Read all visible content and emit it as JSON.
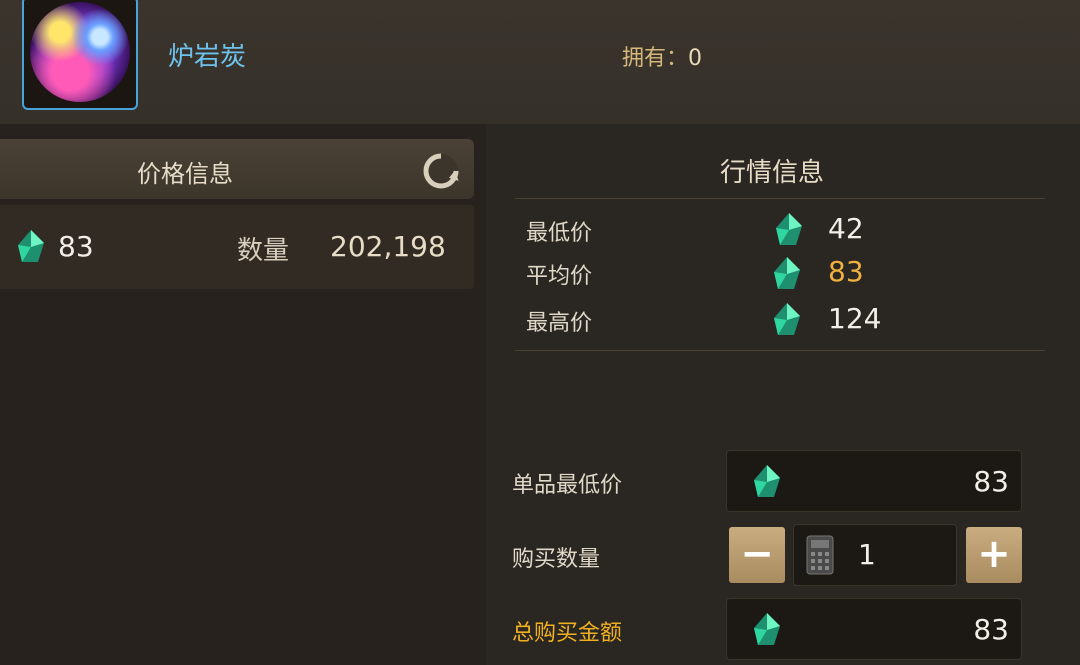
{
  "item": {
    "name": "炉岩炭",
    "owned_label": "拥有：",
    "owned_count": "0",
    "icon": "orb-icon"
  },
  "price_panel": {
    "title": "价格信息",
    "refresh_icon": "refresh-icon",
    "listing": {
      "price": "83",
      "qty_label": "数量",
      "qty": "202,198"
    }
  },
  "market": {
    "title": "行情信息",
    "rows": [
      {
        "label": "最低价",
        "value": "42"
      },
      {
        "label": "平均价",
        "value": "83"
      },
      {
        "label": "最高价",
        "value": "124"
      }
    ]
  },
  "purchase": {
    "unit_price_label": "单品最低价",
    "unit_price": "83",
    "qty_label": "购买数量",
    "qty": "1",
    "minus": "−",
    "plus": "+",
    "total_label": "总购买金额",
    "total": "83"
  },
  "colors": {
    "gem": "#2fd6a0",
    "gold_value": "#f0b040",
    "gold_label": "#f0b020"
  }
}
